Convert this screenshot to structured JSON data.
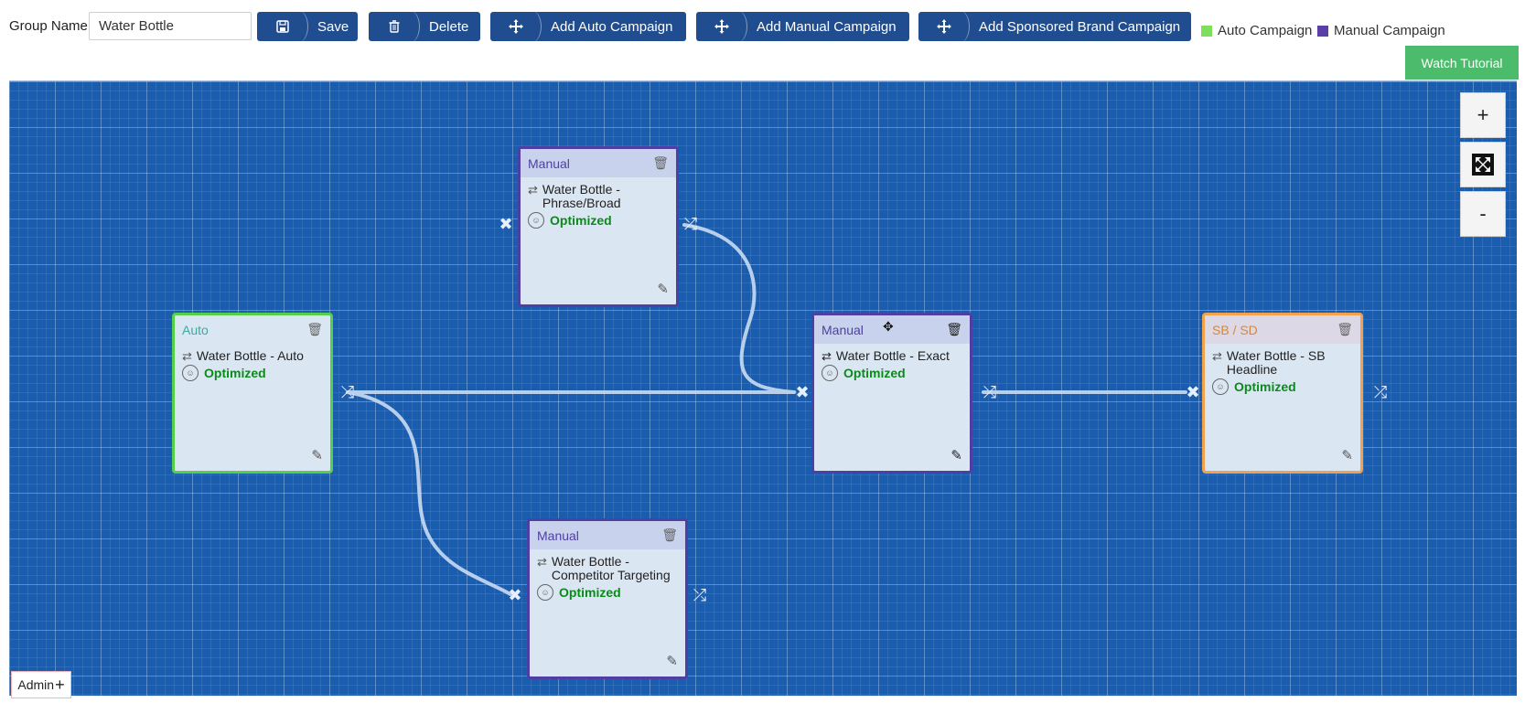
{
  "toolbar": {
    "group_name_label": "Group Name",
    "group_name_value": "Water Bottle",
    "save_label": "Save",
    "delete_label": "Delete",
    "add_auto_label": "Add Auto Campaign",
    "add_manual_label": "Add Manual Campaign",
    "add_sb_label": "Add Sponsored Brand Campaign",
    "save_icon": "floppy-icon",
    "delete_icon": "trash-icon",
    "add_icon": "move-icon"
  },
  "legend": {
    "auto_label": "Auto Campaign",
    "auto_color": "#7ee05a",
    "manual_label": "Manual Campaign",
    "manual_color": "#5a3fa6"
  },
  "watch_tutorial_label": "Watch Tutorial",
  "zoom": {
    "in": "+",
    "fit": "✖",
    "out": "-"
  },
  "colors": {
    "canvas_bg": "#1a5cae",
    "button_bg": "#1f4d8f",
    "auto_border": "#56d04a",
    "manual_border": "#4f3fa3",
    "sb_border": "#f2a14d",
    "optimized_text": "#0b8a1a",
    "watch_tutorial_bg": "#4cbb6c"
  },
  "nodes": [
    {
      "type_label": "Auto",
      "title": "Water Bottle - Auto",
      "status": "Optimized"
    },
    {
      "type_label": "Manual",
      "title": "Water Bottle - Phrase/Broad",
      "status": "Optimized"
    },
    {
      "type_label": "Manual",
      "title": "Water Bottle - Exact",
      "status": "Optimized"
    },
    {
      "type_label": "Manual",
      "title": "Water Bottle - Competitor Targeting",
      "status": "Optimized"
    },
    {
      "type_label": "SB / SD",
      "title": "Water Bottle - SB Headline",
      "status": "Optimized"
    }
  ],
  "admin_label": "Admin"
}
